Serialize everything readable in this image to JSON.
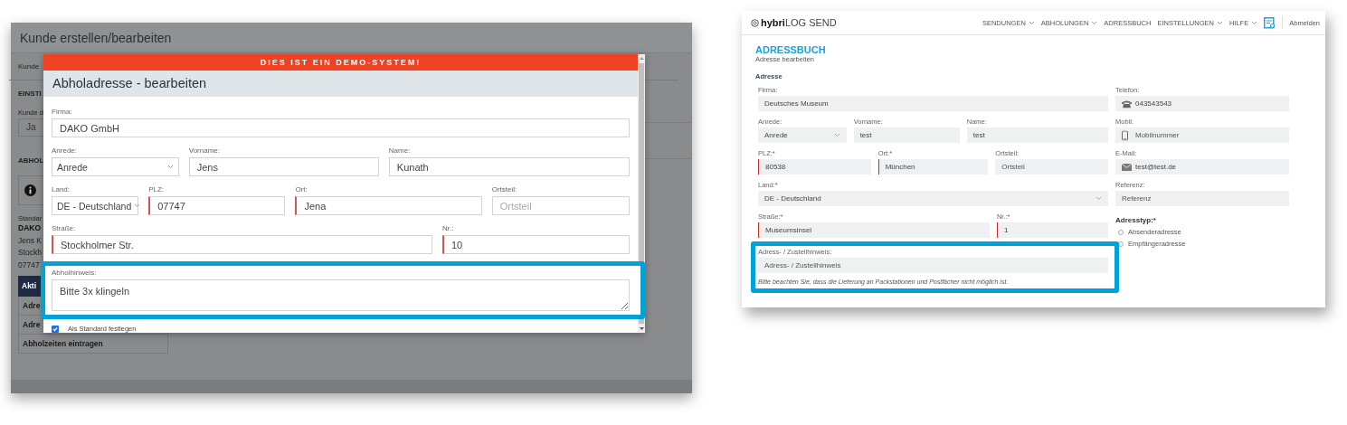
{
  "left": {
    "page_title": "Kunde erstellen/bearbeiten",
    "background": {
      "tab": "Kunde",
      "section": "EINSTI",
      "field_label": "Kunde d",
      "field_value": "Ja",
      "section_2": "ABHOL",
      "caption": "Standar",
      "address_lines": [
        "DAKO",
        "Jens K",
        "Stockh",
        "07747"
      ],
      "actions_header": "Akti",
      "actions": [
        "Adre",
        "Adre",
        "Abholzeiten eintragen"
      ]
    },
    "modal": {
      "banner": "DIES IST EIN DEMO-SYSTEM!",
      "title": "Abholadresse - bearbeiten",
      "rows": [
        [
          {
            "kind": "text",
            "label": "Firma:",
            "value": "DAKO GmbH",
            "required": false
          }
        ],
        [
          {
            "kind": "select",
            "label": "Anrede:",
            "value": "Anrede",
            "required": false
          },
          {
            "kind": "text",
            "label": "Vorname:",
            "value": "Jens",
            "required": false
          },
          {
            "kind": "text",
            "label": "Name:",
            "value": "Kunath",
            "required": false
          }
        ],
        [
          {
            "kind": "select",
            "label": "Land:",
            "value": "DE - Deutschland",
            "required": false
          },
          {
            "kind": "text",
            "label": "PLZ:",
            "value": "07747",
            "required": true
          },
          {
            "kind": "text",
            "label": "Ort:",
            "value": "Jena",
            "required": true
          },
          {
            "kind": "text",
            "label": "Ortsteil:",
            "placeholder": "Ortsteil",
            "required": false
          }
        ],
        [
          {
            "kind": "text",
            "label": "Straße:",
            "value": "Stockholmer Str.",
            "required": true
          },
          {
            "kind": "text",
            "label": "Nr.:",
            "value": "10",
            "required": true
          }
        ]
      ],
      "note_field": {
        "kind": "textarea",
        "label": "Abholhinweis:",
        "value": "Bitte 3x klingeln",
        "required": false
      },
      "checkbox": {
        "label": "Als Standard festlegen",
        "checked": true
      }
    }
  },
  "right": {
    "logo": "**hybri**LOG SEND",
    "nav": [
      {
        "kind": "menu",
        "label": "SENDUNGEN",
        "dropdown": true
      },
      {
        "kind": "menu",
        "label": "ABHOLUNGEN",
        "dropdown": true
      },
      {
        "kind": "menu",
        "label": "ADRESSBUCH",
        "dropdown": false
      },
      {
        "kind": "menu",
        "label": "EINSTELLUNGEN",
        "dropdown": true
      },
      {
        "kind": "menu",
        "label": "HILFE",
        "dropdown": true
      },
      {
        "kind": "icon"
      },
      {
        "kind": "menu",
        "label": "Abmelden",
        "dropdown": false
      }
    ],
    "heading": "ADRESSBUCH",
    "subheading": "Adresse bearbeiten",
    "section": "Adresse",
    "rows": [
      [
        {
          "kind": "text",
          "label": "Firma:",
          "value": "Deutsches Museum",
          "required": false
        }
      ],
      [
        {
          "kind": "select",
          "label": "Anrede:",
          "value": "Anrede",
          "required": false
        },
        {
          "kind": "text",
          "label": "Vorname:",
          "value": "test",
          "required": false
        },
        {
          "kind": "text",
          "label": "Name:",
          "value": "test",
          "required": false
        }
      ],
      [
        {
          "kind": "text",
          "label": "PLZ:*",
          "value": "80538",
          "required": true
        },
        {
          "kind": "text",
          "label": "Ort:*",
          "value": "München",
          "required": true
        },
        {
          "kind": "text",
          "label": "Ortsteil:",
          "placeholder": "Ortsteil",
          "required": false
        }
      ],
      [
        {
          "kind": "select",
          "label": "Land:*",
          "value": "DE - Deutschland",
          "required": false
        }
      ],
      [
        {
          "kind": "text",
          "label": "Straße:*",
          "value": "Museumsinsel",
          "required": true
        },
        {
          "kind": "text",
          "label": "Nr.:*",
          "value": "1",
          "required": true
        }
      ]
    ],
    "note_field": {
      "kind": "text",
      "label": "Adress- / Zustellhinweis:",
      "placeholder": "Adress- / Zustellhinweis",
      "required": false
    },
    "hint": "Bitte beachten Sie, dass die Lieferung an Packstationen und Postfächer nicht möglich ist.",
    "side_fields": [
      {
        "kind": "phone",
        "label": "Telefon:",
        "value": "043543543",
        "required": false
      },
      {
        "kind": "mobile",
        "label": "Mobil:",
        "placeholder": "Mobilnummer",
        "required": false
      },
      {
        "kind": "email",
        "label": "E-Mail:",
        "value": "test@test.de",
        "required": false
      },
      {
        "kind": "text",
        "label": "Referenz:",
        "placeholder": "Referenz",
        "required": false
      }
    ],
    "address_type": {
      "label": "Adresstyp:*",
      "options": [
        {
          "label": "Absenderadresse",
          "selected": false
        },
        {
          "label": "Empfängeradresse",
          "selected": false
        }
      ]
    }
  }
}
